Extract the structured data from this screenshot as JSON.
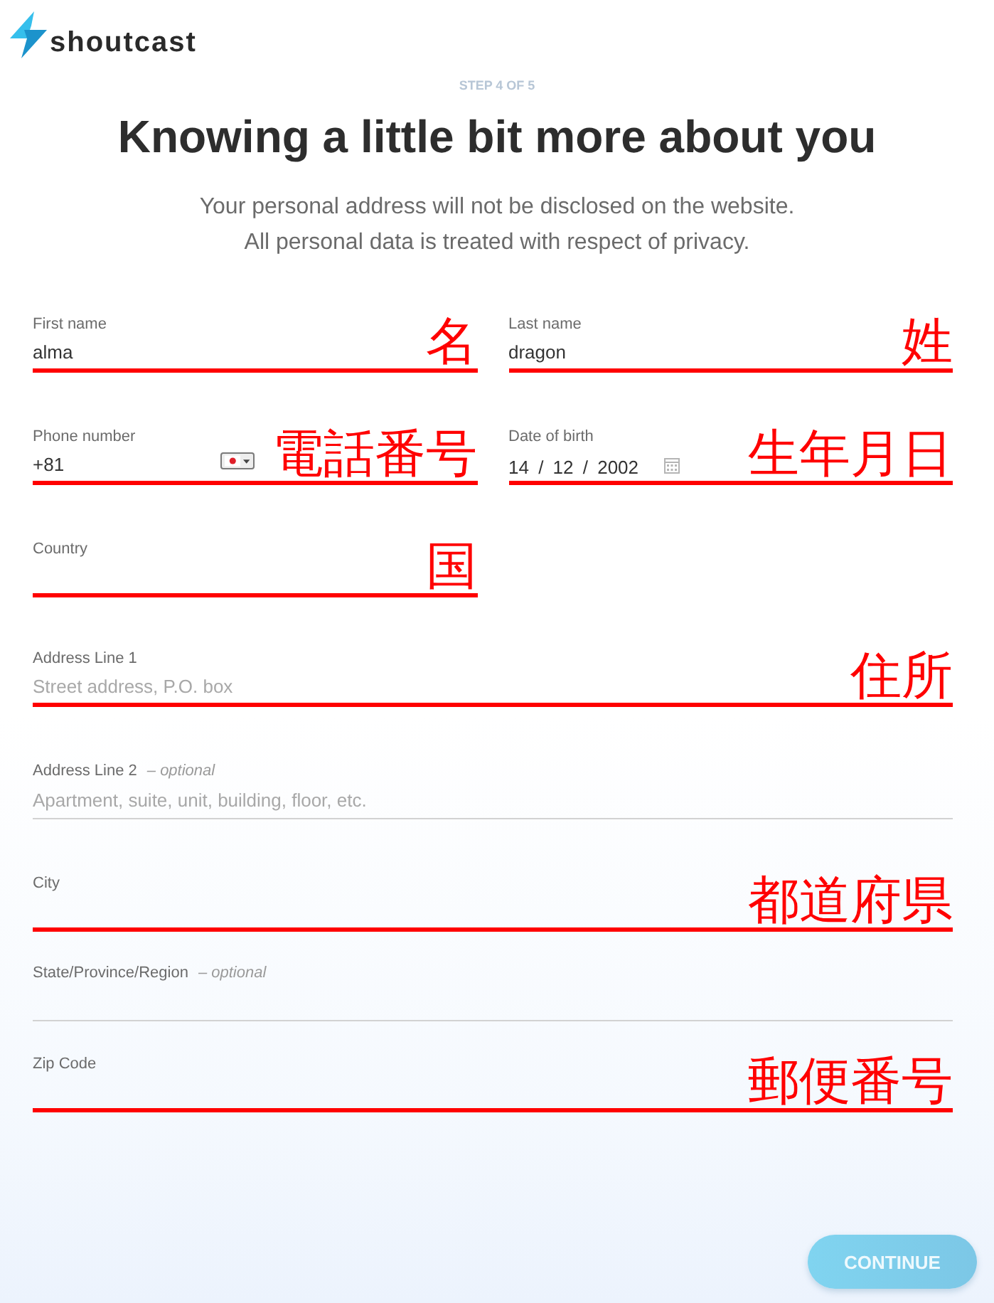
{
  "logo": {
    "text": "shoutcast"
  },
  "step": "STEP 4 OF 5",
  "title": "Knowing a little bit more about you",
  "subtitle_lines": [
    "Your personal address will not be disclosed on the website.",
    "All personal data is treated with respect of privacy."
  ],
  "personal_fields": [
    {
      "kind": "text",
      "label": "First name",
      "value": "alma",
      "highlighted": true,
      "annotation": "名"
    },
    {
      "kind": "text",
      "label": "Last name",
      "value": "dragon",
      "highlighted": true,
      "annotation": "姓"
    },
    {
      "kind": "phone",
      "label": "Phone number",
      "value": "+81",
      "highlighted": true,
      "annotation": "電話番号"
    },
    {
      "kind": "date",
      "label": "Date of birth",
      "value": "14 / 12 / 2002",
      "highlighted": true,
      "annotation": "生年月日"
    },
    {
      "kind": "text",
      "label": "Country",
      "highlighted": true,
      "annotation": "国"
    }
  ],
  "address_fields": [
    {
      "kind": "text",
      "label": "Address Line 1",
      "placeholder": "Street address, P.O. box",
      "highlighted": true,
      "annotation": "住所"
    },
    {
      "kind": "text",
      "label": "Address Line 2",
      "note": "– optional",
      "placeholder": "Apartment, suite, unit, building, floor, etc.",
      "highlighted": false
    },
    {
      "kind": "text",
      "label": "City",
      "highlighted": true,
      "annotation": "都道府県"
    },
    {
      "kind": "text",
      "label": "State/Province/Region",
      "note": "– optional",
      "highlighted": false
    },
    {
      "kind": "text",
      "label": "Zip Code",
      "highlighted": true,
      "annotation": "郵便番号"
    }
  ],
  "continue_button": {
    "label": "CONTINUE",
    "disabled": true
  }
}
